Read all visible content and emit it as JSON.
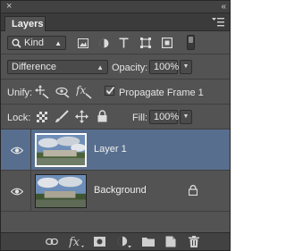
{
  "window": {
    "close_glyph": "×",
    "collapse_glyph": "«"
  },
  "tabs": [
    {
      "label": "Layers",
      "active": true
    }
  ],
  "filter": {
    "kind_label": "Kind",
    "icons": [
      "search-icon",
      "pixel-filter-icon",
      "adjustment-filter-icon",
      "type-filter-icon",
      "shape-filter-icon",
      "smart-object-filter-icon",
      "filter-toggle"
    ]
  },
  "blend": {
    "mode": "Difference",
    "opacity_label": "Opacity:",
    "opacity_value": "100%"
  },
  "unify": {
    "label": "Unify:",
    "propagate_label": "Propagate Frame 1",
    "propagate_checked": true
  },
  "lock": {
    "label": "Lock:",
    "fill_label": "Fill:",
    "fill_value": "100%"
  },
  "layers": [
    {
      "name": "Layer 1",
      "selected": true,
      "visible": true,
      "locked": false
    },
    {
      "name": "Background",
      "selected": false,
      "visible": true,
      "locked": true
    }
  ],
  "bottom_icons": [
    "link-layers-icon",
    "fx-icon",
    "add-mask-icon",
    "adjustment-layer-icon",
    "new-group-icon",
    "new-layer-icon",
    "delete-layer-icon"
  ],
  "colors": {
    "panel": "#535353",
    "selection": "#586e8e",
    "titlebar": "#424242"
  }
}
